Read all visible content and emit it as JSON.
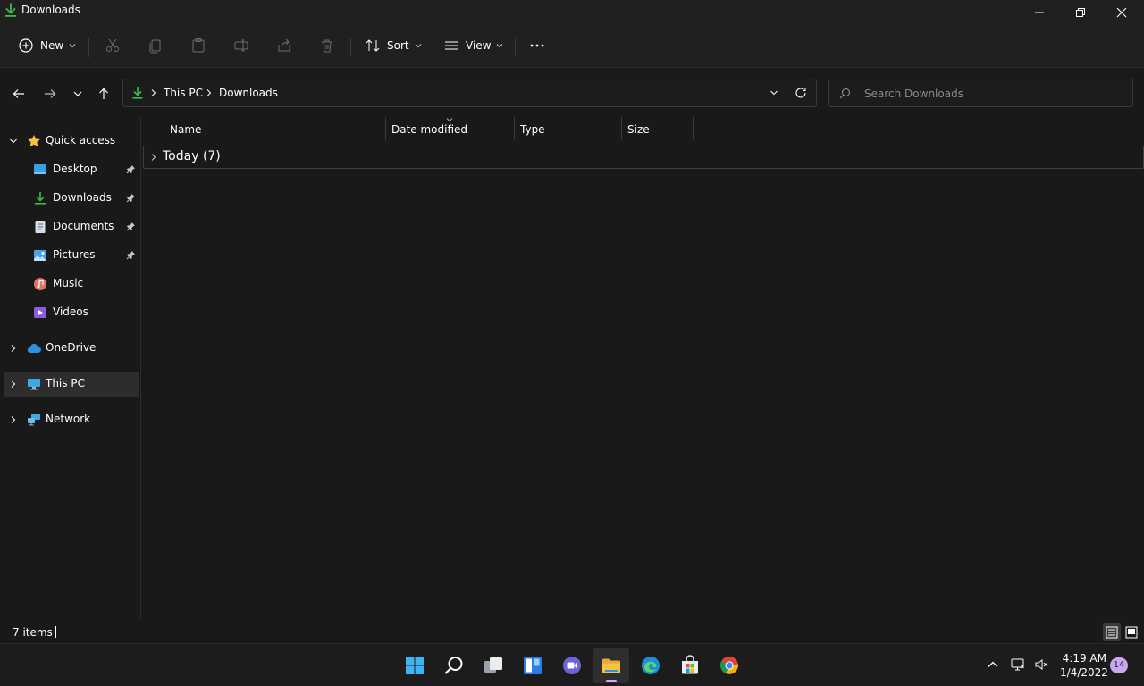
{
  "window": {
    "title": "Downloads"
  },
  "commandbar": {
    "new_label": "New",
    "sort_label": "Sort",
    "view_label": "View"
  },
  "address": {
    "crumbs": [
      "This PC",
      "Downloads"
    ],
    "search_placeholder": "Search Downloads"
  },
  "sidebar": {
    "quick_access": "Quick access",
    "items": [
      {
        "label": "Desktop",
        "icon": "desktop-icon",
        "pinned": true
      },
      {
        "label": "Downloads",
        "icon": "downloads-icon",
        "pinned": true
      },
      {
        "label": "Documents",
        "icon": "documents-icon",
        "pinned": true
      },
      {
        "label": "Pictures",
        "icon": "pictures-icon",
        "pinned": true
      },
      {
        "label": "Music",
        "icon": "music-icon",
        "pinned": false
      },
      {
        "label": "Videos",
        "icon": "videos-icon",
        "pinned": false
      }
    ],
    "onedrive": "OneDrive",
    "thispc": "This PC",
    "network": "Network"
  },
  "columns": [
    "Name",
    "Date modified",
    "Type",
    "Size"
  ],
  "group": {
    "label": "Today (7)"
  },
  "status": {
    "count": "7 items"
  },
  "taskbar": {
    "time": "4:19 AM",
    "date": "1/4/2022",
    "notifications": "14"
  },
  "colors": {
    "background": "#191919",
    "chrome": "#202020",
    "accent_green": "#3fb950",
    "folder_yellow": "#f5c242",
    "selected": "#2d2d2d"
  }
}
